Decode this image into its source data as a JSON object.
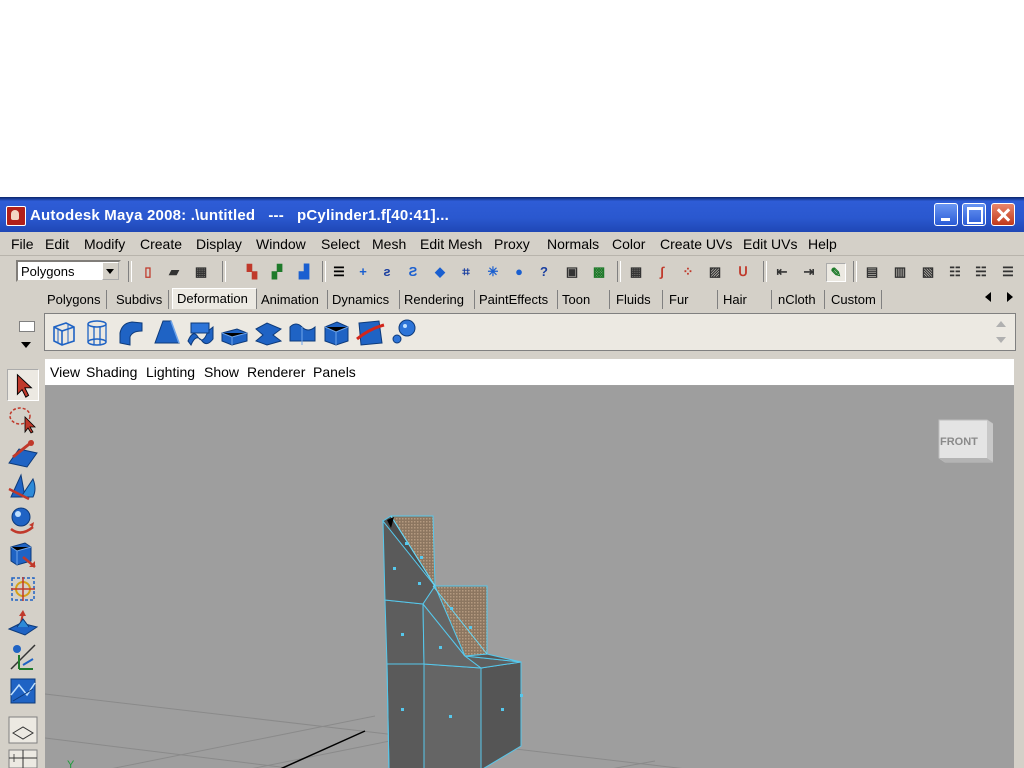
{
  "window": {
    "title": "Autodesk Maya 2008: .\\untitled   ---   pCylinder1.f[40:41]...",
    "icon": "maya-app-icon",
    "controls": [
      "minimize-icon",
      "maximize-icon",
      "close-icon"
    ]
  },
  "menubar": {
    "items": [
      "File",
      "Edit",
      "Modify",
      "Create",
      "Display",
      "Window",
      "Select",
      "Mesh",
      "Edit Mesh",
      "Proxy",
      "Normals",
      "Color",
      "Create UVs",
      "Edit UVs",
      "Help"
    ]
  },
  "statusline": {
    "mode_selector": "Polygons"
  },
  "shelf": {
    "tabs": [
      "Polygons",
      "Subdivs",
      "Deformation",
      "Animation",
      "Dynamics",
      "Rendering",
      "PaintEffects",
      "Toon",
      "Fluids",
      "Fur",
      "Hair",
      "nCloth",
      "Custom"
    ],
    "active_tab": "Deformation",
    "icons": [
      "lattice-icon",
      "cluster-icon",
      "bend-icon",
      "flare-icon",
      "sine-icon",
      "squash-icon",
      "twist-icon",
      "wave-icon",
      "wrap-icon",
      "wire-icon",
      "sculpt-icon"
    ]
  },
  "toolbox": {
    "tools": [
      "select-tool-icon",
      "lasso-tool-icon",
      "paint-select-tool-icon",
      "move-tool-icon",
      "rotate-tool-icon",
      "scale-tool-icon",
      "universal-manipulator-icon",
      "soft-modification-icon",
      "show-manipulator-icon",
      "last-tool-icon"
    ]
  },
  "panel": {
    "menu": [
      "View",
      "Shading",
      "Lighting",
      "Show",
      "Renderer",
      "Panels"
    ],
    "viewcube_label": "FRONT",
    "axis_label": "Y"
  },
  "colors": {
    "title_bar": "#2a58cf",
    "face_border": "#56c8ec",
    "mesh_fill": "#5e5e5e",
    "viewport_bg": "#9e9e9e",
    "selected_face": "#a0876b"
  }
}
